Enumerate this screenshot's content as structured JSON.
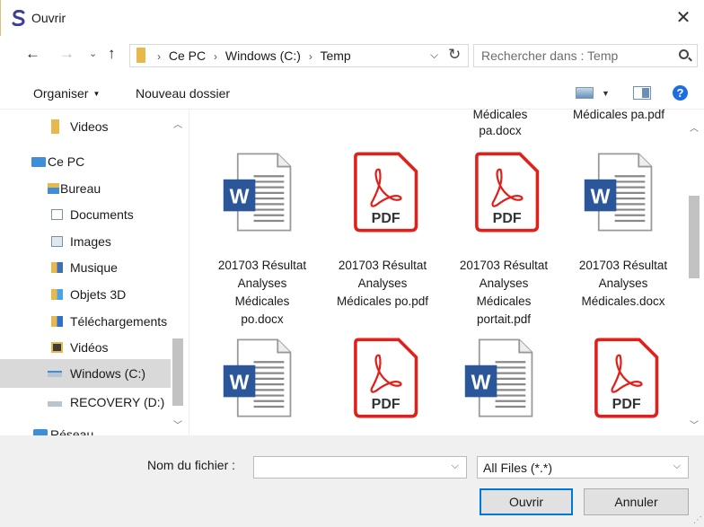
{
  "window": {
    "title": "Ouvrir",
    "close_glyph": "✕",
    "accent": "#0078d7"
  },
  "address": {
    "crumbs": [
      "Ce PC",
      "Windows (C:)",
      "Temp"
    ],
    "separator": "›",
    "search_placeholder": "Rechercher dans : Temp"
  },
  "toolbar": {
    "organize": "Organiser",
    "new_folder": "Nouveau dossier",
    "help": "?"
  },
  "sidebar": {
    "items": [
      {
        "label": "Videos",
        "icon": "folder-icon"
      },
      {
        "label": "Ce PC",
        "icon": "computer-icon"
      },
      {
        "label": "Bureau",
        "icon": "desktop-folder-icon"
      },
      {
        "label": "Documents",
        "icon": "documents-folder-icon"
      },
      {
        "label": "Images",
        "icon": "images-folder-icon"
      },
      {
        "label": "Musique",
        "icon": "music-folder-icon"
      },
      {
        "label": "Objets 3D",
        "icon": "3d-objects-folder-icon"
      },
      {
        "label": "Téléchargements",
        "icon": "downloads-folder-icon"
      },
      {
        "label": "Vidéos",
        "icon": "videos-folder-icon"
      },
      {
        "label": "Windows (C:)",
        "icon": "windows-drive-icon"
      },
      {
        "label": "RECOVERY (D:)",
        "icon": "drive-icon"
      },
      {
        "label": "Réseau",
        "icon": "network-icon"
      }
    ]
  },
  "files": {
    "top_partial": [
      {
        "name_lines": [
          "Médicales",
          "pa.docx"
        ]
      },
      {
        "name_lines": [
          "Médicales pa.pdf"
        ]
      }
    ],
    "row1": [
      {
        "type": "word",
        "name_lines": [
          "201703 Résultat",
          "Analyses",
          "Médicales",
          "po.docx"
        ]
      },
      {
        "type": "pdf",
        "name_lines": [
          "201703 Résultat",
          "Analyses",
          "Médicales po.pdf"
        ]
      },
      {
        "type": "pdf",
        "name_lines": [
          "201703 Résultat",
          "Analyses",
          "Médicales",
          "portait.pdf"
        ]
      },
      {
        "type": "word",
        "name_lines": [
          "201703 Résultat",
          "Analyses",
          "Médicales.docx"
        ]
      }
    ],
    "row2": [
      {
        "type": "word"
      },
      {
        "type": "pdf"
      },
      {
        "type": "word"
      },
      {
        "type": "pdf"
      }
    ],
    "word_letter": "W",
    "pdf_label": "PDF",
    "colors": {
      "word": "#2b579a",
      "pdf": "#e0201b"
    }
  },
  "footer": {
    "filename_label": "Nom du fichier :",
    "filename_value": "",
    "filter_value": "All Files (*.*)",
    "open_label": "Ouvrir",
    "cancel_label": "Annuler"
  }
}
